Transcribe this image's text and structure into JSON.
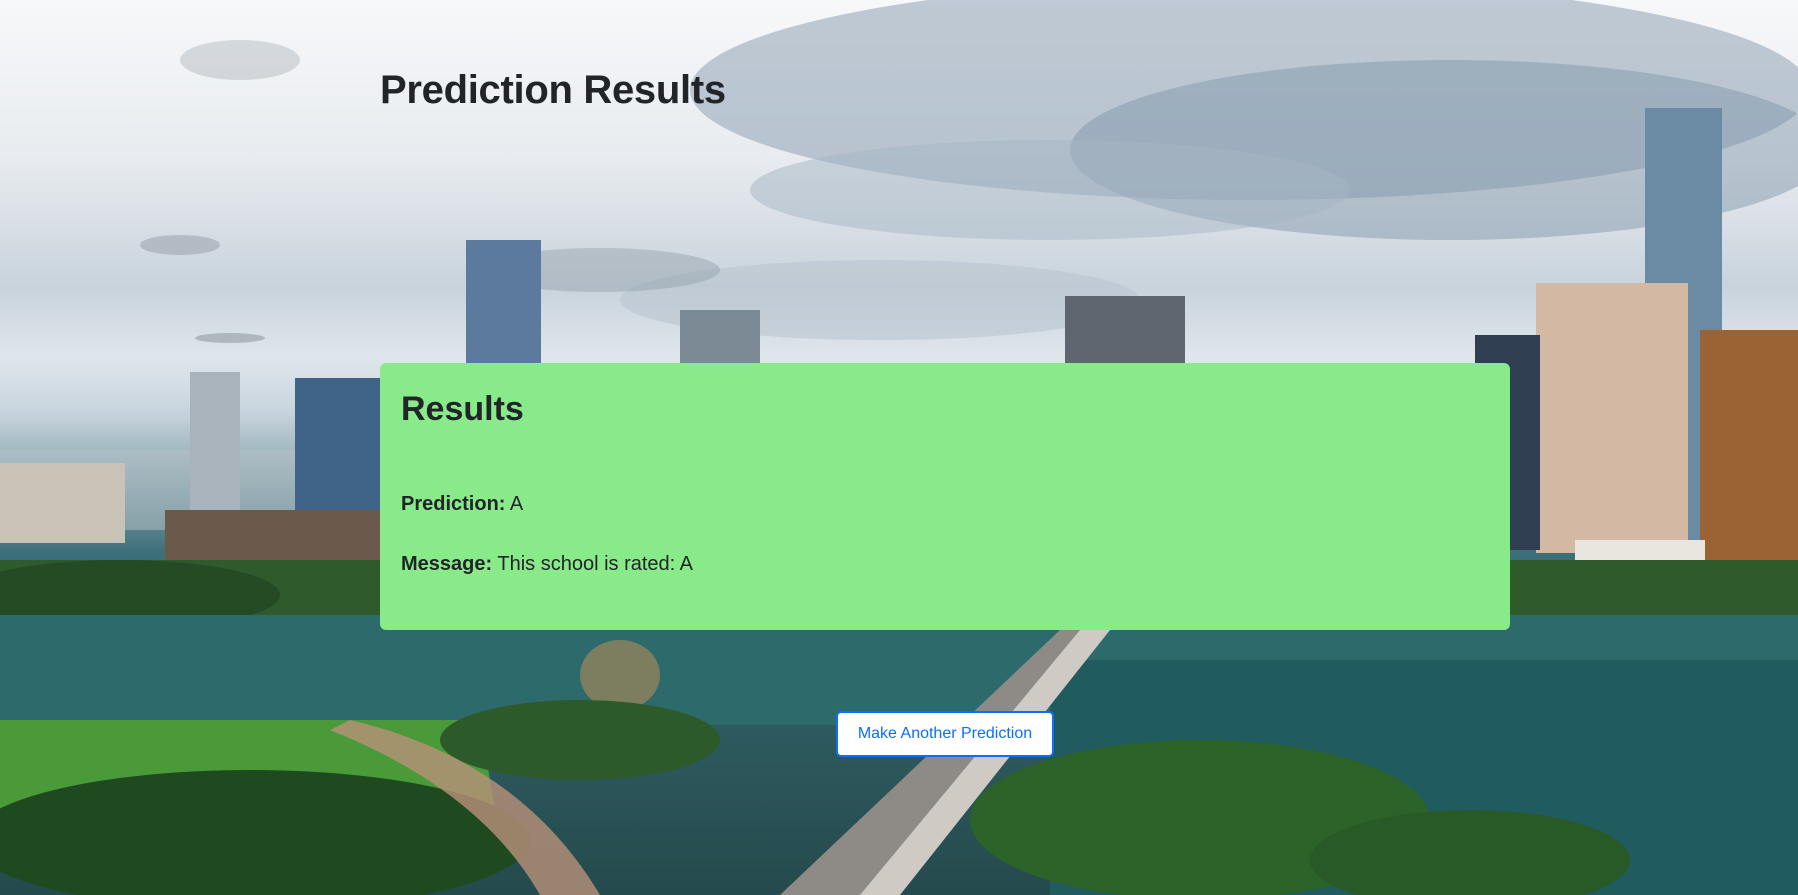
{
  "page": {
    "title": "Prediction Results"
  },
  "results": {
    "heading": "Results",
    "prediction_label": "Prediction:",
    "prediction_value": "A",
    "message_label": "Message:",
    "message_value": "This school is rated: A"
  },
  "actions": {
    "make_another_label": "Make Another Prediction"
  },
  "colors": {
    "card_background": "#89ea89",
    "button_accent": "#0d6efd",
    "title_text": "#212529"
  },
  "background": {
    "icon": "city-skyline-photo"
  }
}
